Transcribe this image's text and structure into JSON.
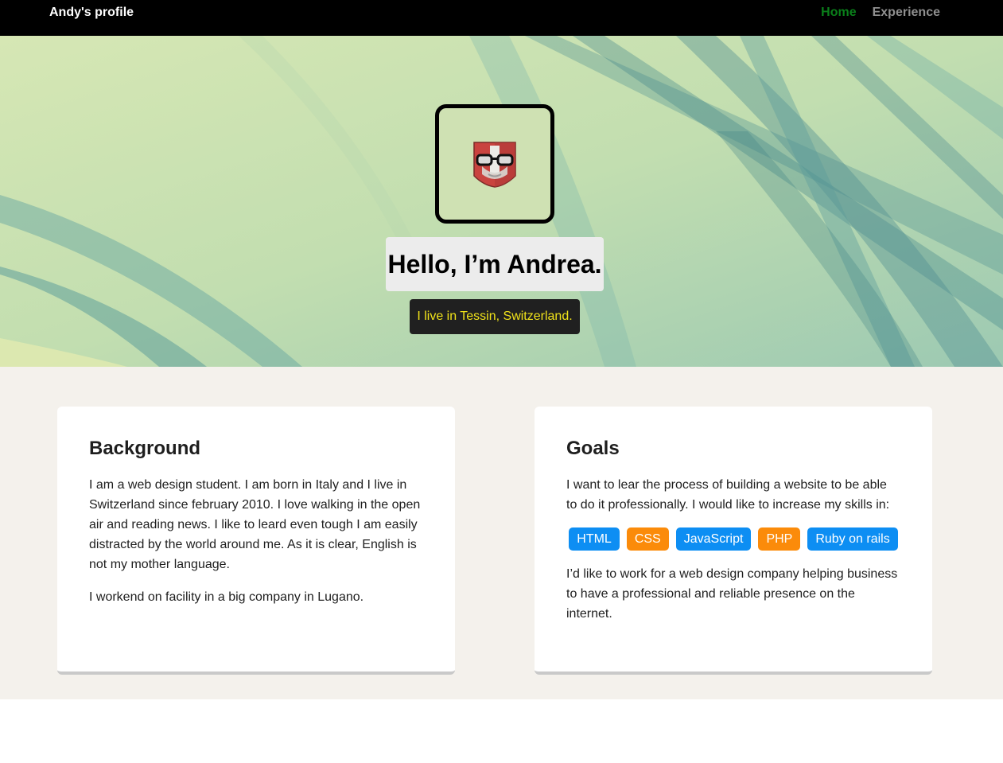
{
  "nav": {
    "brand": "Andy's profile",
    "links": [
      {
        "label": "Home",
        "active": true
      },
      {
        "label": "Experience",
        "active": false
      }
    ]
  },
  "hero": {
    "title": "Hello, I’m Andrea.",
    "subtitle": "I live in Tessin, Switzerland."
  },
  "background_card": {
    "heading": "Background",
    "paragraphs": [
      "I am a web design student. I am born in Italy and I live in Switzerland since february 2010. I love walking in the open air and reading news. I like to leard even tough I am easily distracted by the world around me. As it is clear, English is not my mother language.",
      "I workend on facility in a big company in Lugano."
    ]
  },
  "goals_card": {
    "heading": "Goals",
    "intro": "I want to lear the process of building a website to be able to do it professionally. I would like to increase my skills in:",
    "skills": [
      {
        "label": "HTML",
        "color": "#0d8ef3"
      },
      {
        "label": "CSS",
        "color": "#fb8b0a"
      },
      {
        "label": "JavaScript",
        "color": "#0d8ef3"
      },
      {
        "label": "PHP",
        "color": "#fb8b0a"
      },
      {
        "label": "Ruby on rails",
        "color": "#0d8ef3"
      }
    ],
    "outro": "I’d like to work for a web design company helping business to have a professional and reliable presence on the internet."
  },
  "colors": {
    "nav_active": "#0a7f1a",
    "nav_inactive": "#8f8f8f",
    "subtitle_text": "#f0e21a"
  }
}
